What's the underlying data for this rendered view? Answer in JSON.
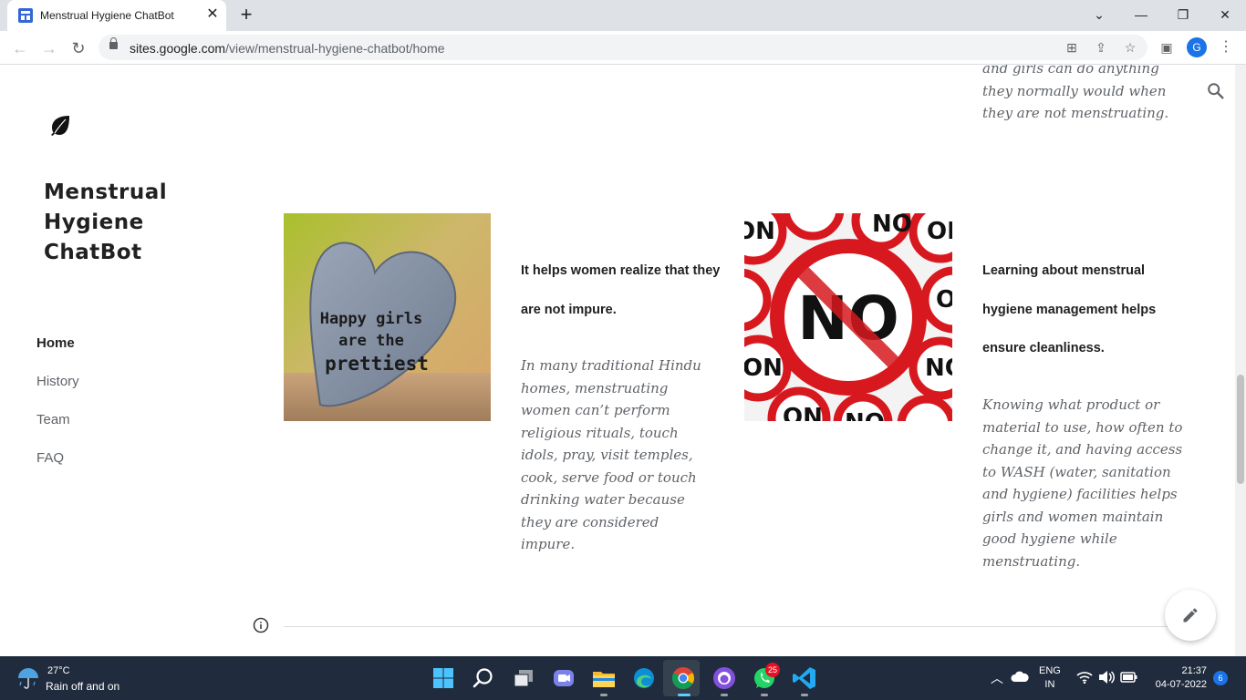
{
  "browser": {
    "tab_title": "Menstrual Hygiene ChatBot",
    "tab_close": "✕",
    "new_tab": "+",
    "url_host": "sites.google.com",
    "url_path": "/view/menstrual-hygiene-chatbot/home",
    "profile_initial": "G",
    "window_minimize": "—",
    "window_restore": "❐",
    "window_close": "✕",
    "tab_search": "⌄"
  },
  "site": {
    "title": "Menstrual Hygiene ChatBot",
    "nav": [
      {
        "label": "Home",
        "active": true
      },
      {
        "label": "History",
        "active": false
      },
      {
        "label": "Team",
        "active": false
      },
      {
        "label": "FAQ",
        "active": false
      }
    ]
  },
  "content": {
    "top_text": "and girls can do anything they normally would when they are not menstruating.",
    "heart_image_text": [
      "Happy girls",
      "are the",
      "prettiest"
    ],
    "no_image_text": "NO",
    "section1": {
      "heading": "It helps women realize that they are not impure.",
      "body": "In many traditional Hindu homes, menstruating women can’t perform religious rituals, touch idols, pray, visit temples, cook, serve food or touch drinking water because they are considered impure."
    },
    "section2": {
      "heading": "Learning about menstrual hygiene management helps ensure cleanliness.",
      "body": "Knowing what product or material to use, how often to change it, and having access to WASH (water, sanitation and hygiene) facilities helps girls and women maintain good hygiene while menstruating."
    }
  },
  "taskbar": {
    "temperature": "27°C",
    "weather": "Rain off and on",
    "whatsapp_badge": "25",
    "language_line1": "ENG",
    "language_line2": "IN",
    "time": "21:37",
    "date": "04-07-2022",
    "notifications": "6"
  },
  "colors": {
    "accent": "#1a73e8",
    "taskbar": "#202c3d",
    "nav_active": "#212121",
    "nav_inactive": "#5f6368"
  },
  "icons": [
    "leaf-icon",
    "search-icon",
    "info-icon",
    "pencil-icon",
    "windows-start-icon",
    "chrome-icon",
    "whatsapp-icon",
    "vscode-icon"
  ]
}
